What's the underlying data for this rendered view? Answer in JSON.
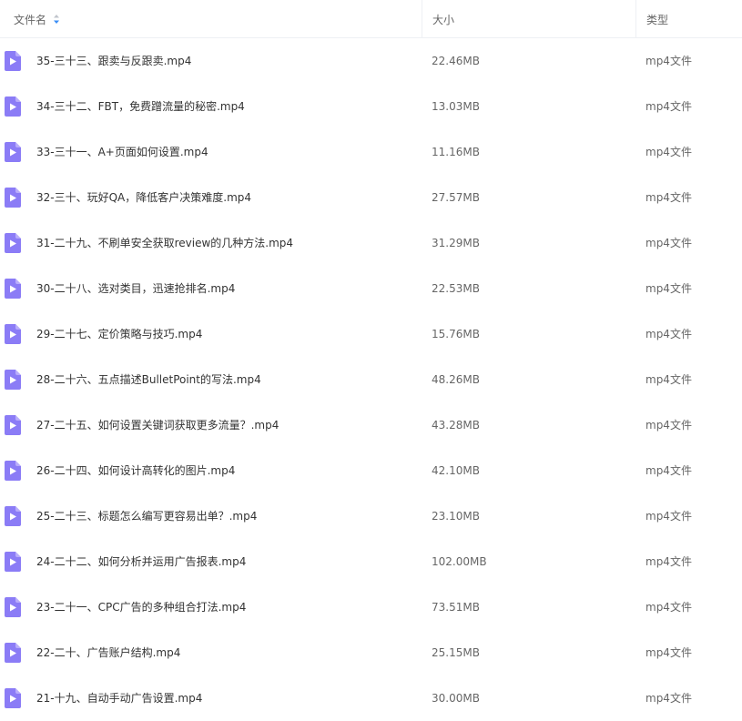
{
  "header": {
    "name_label": "文件名",
    "size_label": "大小",
    "type_label": "类型"
  },
  "colors": {
    "video_icon": "#8b7cf6",
    "sort_active": "#3a8ef6"
  },
  "icons": {
    "file": "video-file-icon",
    "sort": "sort-icon"
  },
  "files": [
    {
      "name": "35-三十三、跟卖与反跟卖.mp4",
      "size": "22.46MB",
      "type": "mp4文件"
    },
    {
      "name": "34-三十二、FBT，免费蹭流量的秘密.mp4",
      "size": "13.03MB",
      "type": "mp4文件"
    },
    {
      "name": "33-三十一、A+页面如何设置.mp4",
      "size": "11.16MB",
      "type": "mp4文件"
    },
    {
      "name": "32-三十、玩好QA，降低客户决策难度.mp4",
      "size": "27.57MB",
      "type": "mp4文件"
    },
    {
      "name": "31-二十九、不刷单安全获取review的几种方法.mp4",
      "size": "31.29MB",
      "type": "mp4文件"
    },
    {
      "name": "30-二十八、选对类目，迅速抢排名.mp4",
      "size": "22.53MB",
      "type": "mp4文件"
    },
    {
      "name": "29-二十七、定价策略与技巧.mp4",
      "size": "15.76MB",
      "type": "mp4文件"
    },
    {
      "name": "28-二十六、五点描述BulletPoint的写法.mp4",
      "size": "48.26MB",
      "type": "mp4文件"
    },
    {
      "name": "27-二十五、如何设置关键词获取更多流量？.mp4",
      "size": "43.28MB",
      "type": "mp4文件"
    },
    {
      "name": "26-二十四、如何设计高转化的图片.mp4",
      "size": "42.10MB",
      "type": "mp4文件"
    },
    {
      "name": "25-二十三、标题怎么编写更容易出单？.mp4",
      "size": "23.10MB",
      "type": "mp4文件"
    },
    {
      "name": "24-二十二、如何分析并运用广告报表.mp4",
      "size": "102.00MB",
      "type": "mp4文件"
    },
    {
      "name": "23-二十一、CPC广告的多种组合打法.mp4",
      "size": "73.51MB",
      "type": "mp4文件"
    },
    {
      "name": "22-二十、广告账户结构.mp4",
      "size": "25.15MB",
      "type": "mp4文件"
    },
    {
      "name": "21-十九、自动手动广告设置.mp4",
      "size": "30.00MB",
      "type": "mp4文件"
    }
  ]
}
